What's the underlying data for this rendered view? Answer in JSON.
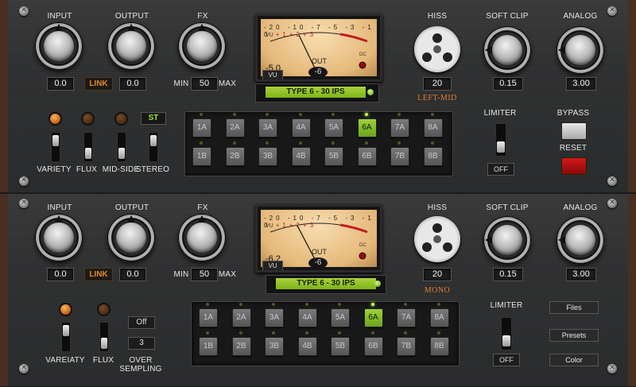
{
  "top": {
    "input_label": "INPUT",
    "output_label": "OUTPUT",
    "fx_label": "FX",
    "hiss_label": "HISS",
    "soft_clip_label": "SOFT CLIP",
    "analog_label": "ANALOG",
    "input_value": "0.0",
    "link": "LINK",
    "output_value": "0.0",
    "fx_min": "MIN",
    "fx_value": "50",
    "fx_max": "MAX",
    "hiss_value": "20",
    "hiss_mode": "LEFT-MID",
    "soft_clip_value": "0.15",
    "analog_value": "3.00",
    "meter": {
      "scale": [
        "VU",
        "-20",
        "-10",
        "-7",
        "-5",
        "-3",
        "-1",
        "0",
        "+1",
        "+2",
        "+3"
      ],
      "out_label": "OUT",
      "dc_label": "DC",
      "left_reading": "-5.0",
      "right_reading": "-6",
      "mode": "VU"
    },
    "type_display": "TYPE 6 - 30 IPS",
    "buttons_row_a": [
      "1A",
      "2A",
      "3A",
      "4A",
      "5A",
      "6A",
      "7A",
      "8A"
    ],
    "buttons_row_b": [
      "1B",
      "2B",
      "3B",
      "4B",
      "5B",
      "6B",
      "7B",
      "8B"
    ],
    "selected_button": "6A",
    "variety_label": "VARIETY",
    "flux_label": "FLUX",
    "midside_label": "MID-SIDE",
    "stereo_label": "STEREO",
    "stereo_value": "ST",
    "limiter_label": "LIMITER",
    "limiter_value": "OFF",
    "bypass_label": "BYPASS",
    "reset_label": "RESET"
  },
  "bottom": {
    "input_label": "INPUT",
    "output_label": "OUTPUT",
    "fx_label": "FX",
    "hiss_label": "HISS",
    "soft_clip_label": "SOFT CLIP",
    "analog_label": "ANALOG",
    "input_value": "0.0",
    "link": "LINK",
    "output_value": "0.0",
    "fx_min": "MIN",
    "fx_value": "50",
    "fx_max": "MAX",
    "hiss_value": "20",
    "hiss_mode": "MONO",
    "soft_clip_value": "0.15",
    "analog_value": "3.00",
    "meter": {
      "scale": [
        "VU",
        "-20",
        "-10",
        "-7",
        "-5",
        "-3",
        "-1",
        "0",
        "+1",
        "+2",
        "+3"
      ],
      "out_label": "OUT",
      "dc_label": "DC",
      "left_reading": "-6.2",
      "right_reading": "-6",
      "mode": "VU"
    },
    "type_display": "TYPE 6 - 30 IPS",
    "buttons_row_a": [
      "1A",
      "2A",
      "3A",
      "4A",
      "5A",
      "6A",
      "7A",
      "8A"
    ],
    "buttons_row_b": [
      "1B",
      "2B",
      "3B",
      "4B",
      "5B",
      "6B",
      "7B",
      "8B"
    ],
    "selected_button": "6A",
    "variety_label": "VAREIATY",
    "flux_label": "FLUX",
    "oversampling_label_1": "OVER",
    "oversampling_label_2": "SEMPLING",
    "oversampling_mode": "Off",
    "oversampling_factor": "3",
    "limiter_label": "LIMITER",
    "limiter_value": "OFF",
    "files_label": "Files",
    "presets_label": "Presets",
    "color_label": "Color"
  },
  "colors": {
    "accent_orange": "#e07a2a",
    "selected_green": "#8cc52a",
    "wood": "#4a2e22",
    "reset_red": "#c01010"
  }
}
